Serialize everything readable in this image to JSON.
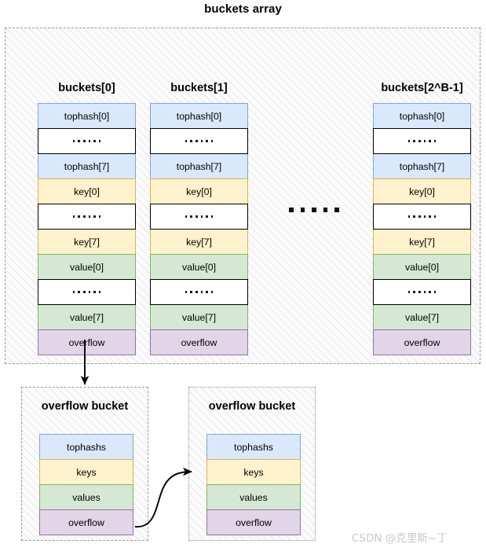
{
  "diagram": {
    "title": "buckets array",
    "watermark": "CSDN @克里斯~丁",
    "ellipsis_glyph": "......"
  },
  "colors": {
    "tophash": "#dae8fc",
    "tophash_border": "#7ea6dc",
    "key": "#fff2cc",
    "key_border": "#d6b656",
    "value": "#d5e8d4",
    "value_border": "#82b366",
    "overflow": "#e1d5e7",
    "overflow_border": "#9673a6",
    "container_border": "#999999",
    "hatch": "#e8e8e8"
  },
  "buckets": [
    {
      "label": "buckets[0]",
      "cells": [
        {
          "text": "tophash[0]",
          "kind": "blue"
        },
        {
          "text": "......",
          "kind": "plain"
        },
        {
          "text": "tophash[7]",
          "kind": "blue"
        },
        {
          "text": "key[0]",
          "kind": "yellow"
        },
        {
          "text": "......",
          "kind": "plain"
        },
        {
          "text": "key[7]",
          "kind": "yellow"
        },
        {
          "text": "value[0]",
          "kind": "green"
        },
        {
          "text": "......",
          "kind": "plain"
        },
        {
          "text": "value[7]",
          "kind": "green"
        },
        {
          "text": "overflow",
          "kind": "purple"
        }
      ]
    },
    {
      "label": "buckets[1]",
      "cells": [
        {
          "text": "tophash[0]",
          "kind": "blue"
        },
        {
          "text": "......",
          "kind": "plain"
        },
        {
          "text": "tophash[7]",
          "kind": "blue"
        },
        {
          "text": "key[0]",
          "kind": "yellow"
        },
        {
          "text": "......",
          "kind": "plain"
        },
        {
          "text": "key[7]",
          "kind": "yellow"
        },
        {
          "text": "value[0]",
          "kind": "green"
        },
        {
          "text": "......",
          "kind": "plain"
        },
        {
          "text": "value[7]",
          "kind": "green"
        },
        {
          "text": "overflow",
          "kind": "purple"
        }
      ]
    },
    {
      "label": "buckets[2^B-1]",
      "cells": [
        {
          "text": "tophash[0]",
          "kind": "blue"
        },
        {
          "text": "......",
          "kind": "plain"
        },
        {
          "text": "tophash[7]",
          "kind": "blue"
        },
        {
          "text": "key[0]",
          "kind": "yellow"
        },
        {
          "text": "......",
          "kind": "plain"
        },
        {
          "text": "key[7]",
          "kind": "yellow"
        },
        {
          "text": "value[0]",
          "kind": "green"
        },
        {
          "text": "......",
          "kind": "plain"
        },
        {
          "text": "value[7]",
          "kind": "green"
        },
        {
          "text": "overflow",
          "kind": "purple"
        }
      ]
    }
  ],
  "overflow_buckets": [
    {
      "title": "overflow bucket",
      "cells": [
        {
          "text": "tophashs",
          "kind": "blue"
        },
        {
          "text": "keys",
          "kind": "yellow"
        },
        {
          "text": "values",
          "kind": "green"
        },
        {
          "text": "overflow",
          "kind": "purple"
        }
      ]
    },
    {
      "title": "overflow bucket",
      "cells": [
        {
          "text": "tophashs",
          "kind": "blue"
        },
        {
          "text": "keys",
          "kind": "yellow"
        },
        {
          "text": "values",
          "kind": "green"
        },
        {
          "text": "overflow",
          "kind": "purple"
        }
      ]
    }
  ],
  "arrows": [
    {
      "name": "bucket0-overflow-to-overflow-bucket-1",
      "style": "straight-down"
    },
    {
      "name": "overflow-bucket-1-to-overflow-bucket-2",
      "style": "s-curve"
    }
  ]
}
